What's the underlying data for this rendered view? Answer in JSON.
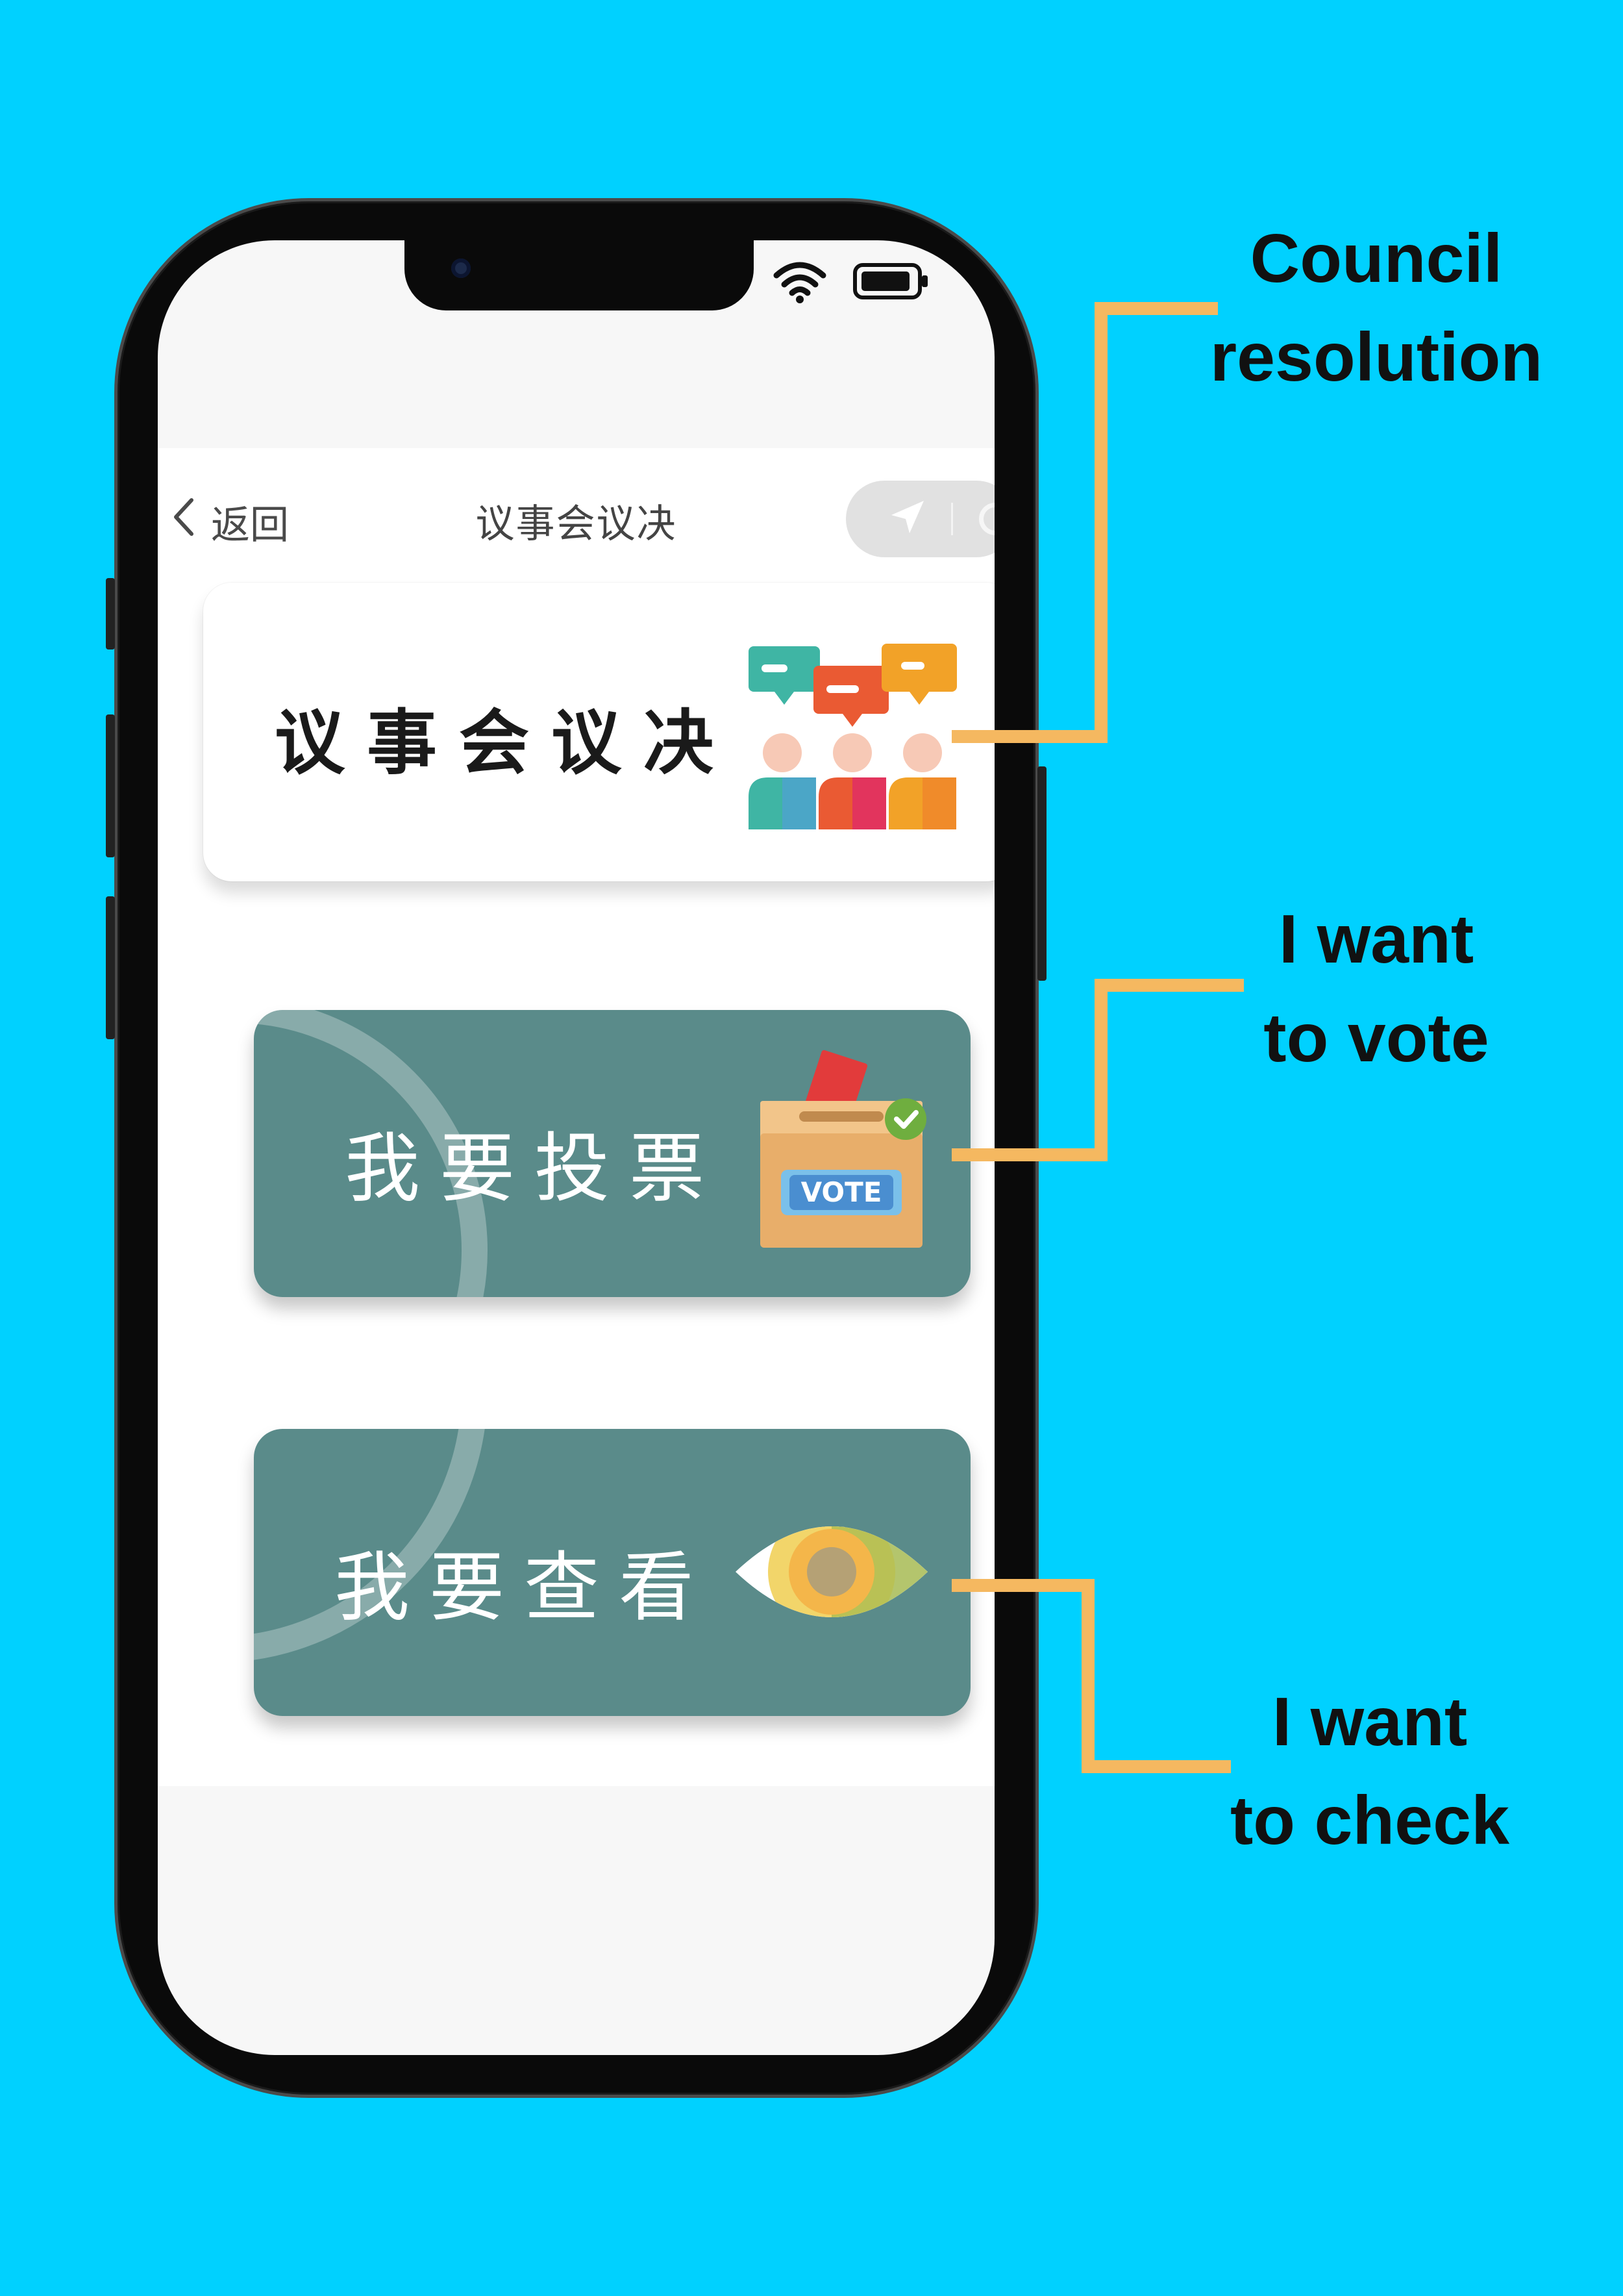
{
  "status_bar": {
    "wifi_icon": "wifi-icon",
    "battery_icon": "battery-icon"
  },
  "nav": {
    "back_label": "返回",
    "title": "议事会议决"
  },
  "cards": {
    "council": {
      "label": "议事会议决",
      "icon": "council-speech-people-icon"
    },
    "vote": {
      "label": "我要投票",
      "icon": "ballot-box-icon",
      "icon_text": "VOTE"
    },
    "check": {
      "label": "我要查看",
      "icon": "eye-icon"
    }
  },
  "annotations": {
    "council_line1": "Council",
    "council_line2": "resolution",
    "vote_line1": "I want",
    "vote_line2": "to vote",
    "check_line1": "I want",
    "check_line2": "to check"
  },
  "colors": {
    "background": "#00d1ff",
    "teal_card": "#5a8b8a",
    "connector": "#f5b860"
  }
}
